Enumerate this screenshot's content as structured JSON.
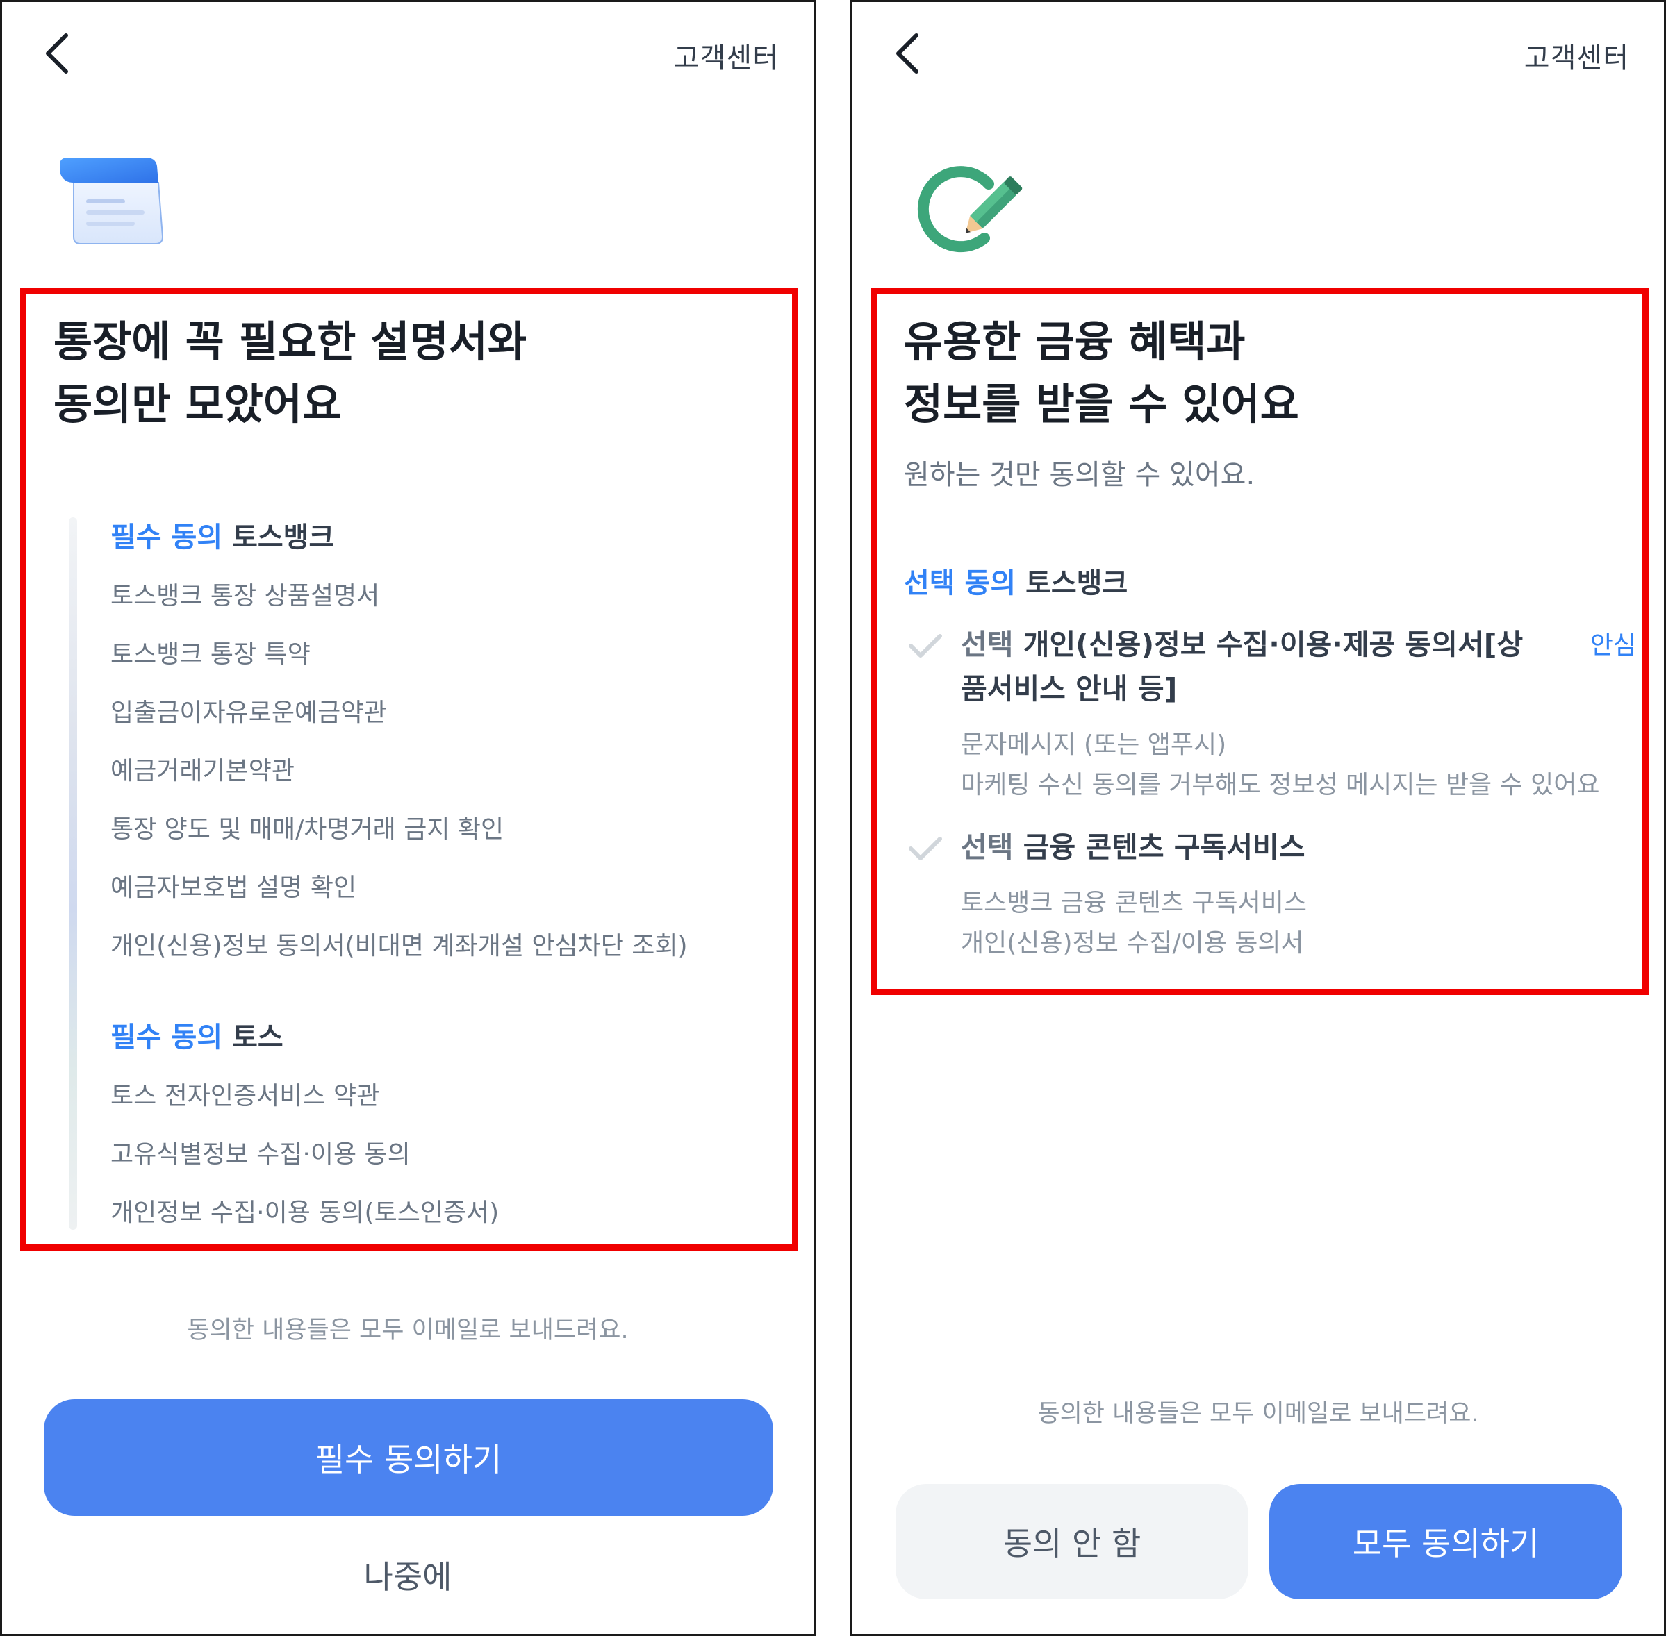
{
  "left_screen": {
    "header": {
      "support_label": "고객센터"
    },
    "title_lines": [
      "통장에 꼭 필요한 설명서와",
      "동의만 모았어요"
    ],
    "sections": [
      {
        "tag": "필수 동의",
        "provider": "토스뱅크",
        "items": [
          "토스뱅크 통장 상품설명서",
          "토스뱅크 통장 특약",
          "입출금이자유로운예금약관",
          "예금거래기본약관",
          "통장 양도 및 매매/차명거래 금지 확인",
          "예금자보호법 설명 확인",
          "개인(신용)정보 동의서(비대면 계좌개설 안심차단 조회)"
        ]
      },
      {
        "tag": "필수 동의",
        "provider": "토스",
        "items": [
          "토스 전자인증서비스 약관",
          "고유식별정보 수집·이용 동의",
          "개인정보 수집·이용 동의(토스인증서)"
        ]
      }
    ],
    "footer_note": "동의한 내용들은 모두 이메일로 보내드려요.",
    "primary_button": "필수 동의하기",
    "later_button": "나중에"
  },
  "right_screen": {
    "header": {
      "support_label": "고객센터"
    },
    "title_lines": [
      "유용한 금융 혜택과",
      "정보를 받을 수 있어요"
    ],
    "subtitle": "원하는 것만 동의할 수 있어요.",
    "section": {
      "tag": "선택 동의",
      "provider": "토스뱅크"
    },
    "options": [
      {
        "tag": "선택",
        "label_line1": "개인(신용)정보 수집·이용·제공 동의서[상",
        "label_line2": "품서비스 안내 등]",
        "badge": "안심",
        "desc": [
          "문자메시지 (또는 앱푸시)",
          "마케팅 수신 동의를 거부해도 정보성 메시지는 받을 수 있어요"
        ]
      },
      {
        "tag": "선택",
        "label_line1": "금융 콘텐츠 구독서비스",
        "desc": [
          "토스뱅크 금융 콘텐츠 구독서비스",
          "개인(신용)정보 수집/이용 동의서"
        ]
      }
    ],
    "footer_note": "동의한 내용들은 모두 이메일로 보내드려요.",
    "decline_button": "동의 안 함",
    "agree_all_button": "모두 동의하기"
  },
  "colors": {
    "accent": "#3182f6",
    "button_blue": "#4b83f0",
    "highlight_red": "#f00000",
    "secondary_bg": "#f2f4f6"
  },
  "icons": [
    "back-chevron-icon",
    "document-icon",
    "pencil-circle-icon",
    "checkmark-icon"
  ]
}
